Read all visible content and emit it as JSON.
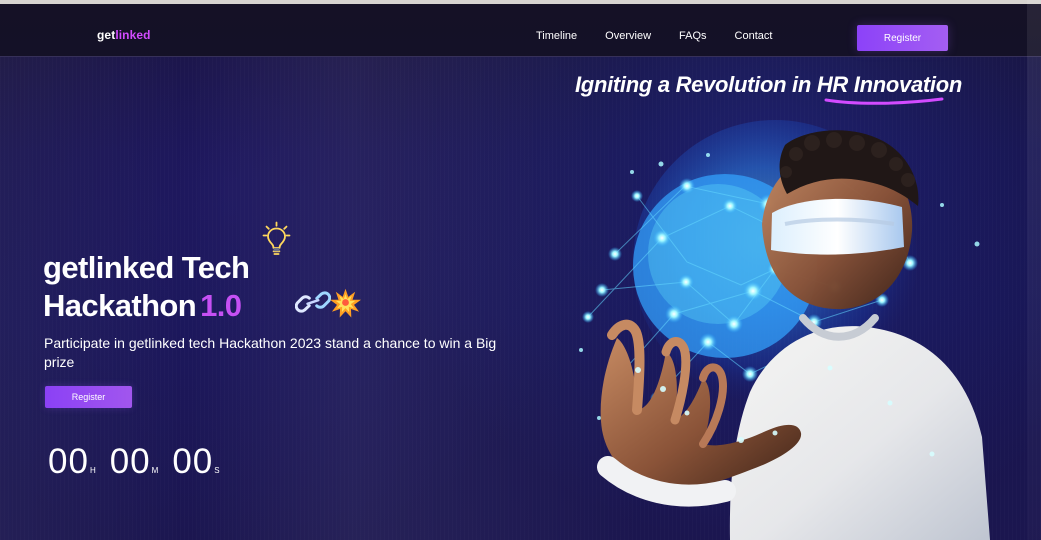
{
  "header": {
    "logo": {
      "primary": "get",
      "accent": "linked"
    },
    "nav": [
      {
        "label": "Timeline"
      },
      {
        "label": "Overview"
      },
      {
        "label": "FAQs"
      },
      {
        "label": "Contact"
      }
    ],
    "register_label": "Register"
  },
  "hero": {
    "tagline": "Igniting a Revolution in HR Innovation",
    "title_line_1": "getlinked Tech",
    "title_line_2_text": "Hackathon",
    "title_version": "1.0",
    "subtitle": "Participate in getlinked tech Hackathon 2023 stand a chance to win a Big prize",
    "register_label": "Register",
    "countdown": [
      {
        "value": "00",
        "label": "H"
      },
      {
        "value": "00",
        "label": "M"
      },
      {
        "value": "00",
        "label": "S"
      }
    ]
  },
  "icons": {
    "bulb": "lightbulb-icon",
    "chain": "link-chain-icon",
    "burst": "spark-burst-icon"
  },
  "colors": {
    "accent_purple": "#9e57f7",
    "accent_pink": "#d24bff",
    "background_navy": "#17144f",
    "text_white": "#ffffff"
  }
}
